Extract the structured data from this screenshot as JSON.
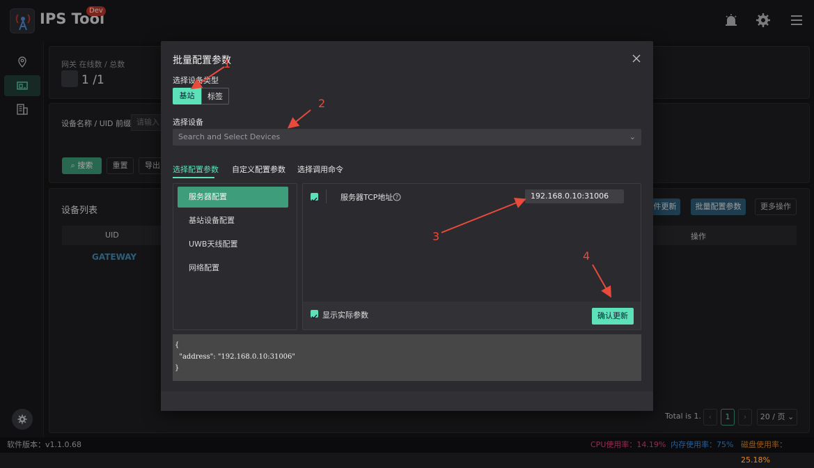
{
  "header": {
    "app_title": "IPS Tool",
    "dev_badge": "Dev",
    "icons": [
      "alarm-icon",
      "gear-icon",
      "menu-icon"
    ]
  },
  "sidebar": {
    "items": [
      "map-pin-icon",
      "devices-icon",
      "building-icon"
    ],
    "active_index": 1,
    "bottom_icon": "gear-icon"
  },
  "stats": {
    "label": "网关 在线数 / 总数",
    "value": "1 /1"
  },
  "search": {
    "label": "设备名称 / UID 前缀",
    "placeholder": "请输入",
    "search_button": "搜索",
    "reset_button": "重置",
    "export_button": "导出"
  },
  "device_list": {
    "title": "设备列表",
    "buttons": {
      "firmware_update": "件更新",
      "batch_config": "批量配置参数",
      "more_actions": "更多操作"
    },
    "columns": [
      "UID",
      "操作"
    ],
    "rows": [
      [
        "GATEWAY"
      ]
    ],
    "pagination": {
      "total": "Total is 1.",
      "current_page": "1",
      "page_size": "20 / 页"
    }
  },
  "footer": {
    "version": "软件版本：v1.1.0.68",
    "cpu": "CPU使用率：14.19%",
    "memory": "内存使用率：75%",
    "disk": "磁盘使用率：25.18%",
    "colors": {
      "cpu": "#e0447a",
      "memory": "#3f8fe0",
      "disk": "#e08a2a"
    }
  },
  "modal": {
    "title": "批量配置参数",
    "device_type_label": "选择设备类型",
    "device_types": [
      "基站",
      "标签"
    ],
    "selected_device_type": "基站",
    "select_devices_label": "选择设备",
    "select_devices_placeholder": "Search and Select Devices",
    "tabs": [
      "选择配置参数",
      "自定义配置参数",
      "选择调用命令"
    ],
    "active_tab": "选择配置参数",
    "menu": [
      "服务器配置",
      "基站设备配置",
      "UWB天线配置",
      "网络配置"
    ],
    "active_menu": "服务器配置",
    "param": {
      "checked": true,
      "label": "服务器TCP地址",
      "value": "192.168.0.10:31006"
    },
    "show_actual_params": {
      "checked": true,
      "label": "显示实际参数"
    },
    "confirm_button": "确认更新",
    "json_preview": [
      "{",
      "  \"address\": \"192.168.0.10:31006\"",
      "}"
    ]
  },
  "annotations": [
    "1",
    "2",
    "3",
    "4"
  ],
  "accent_color": "#5ce1b8"
}
